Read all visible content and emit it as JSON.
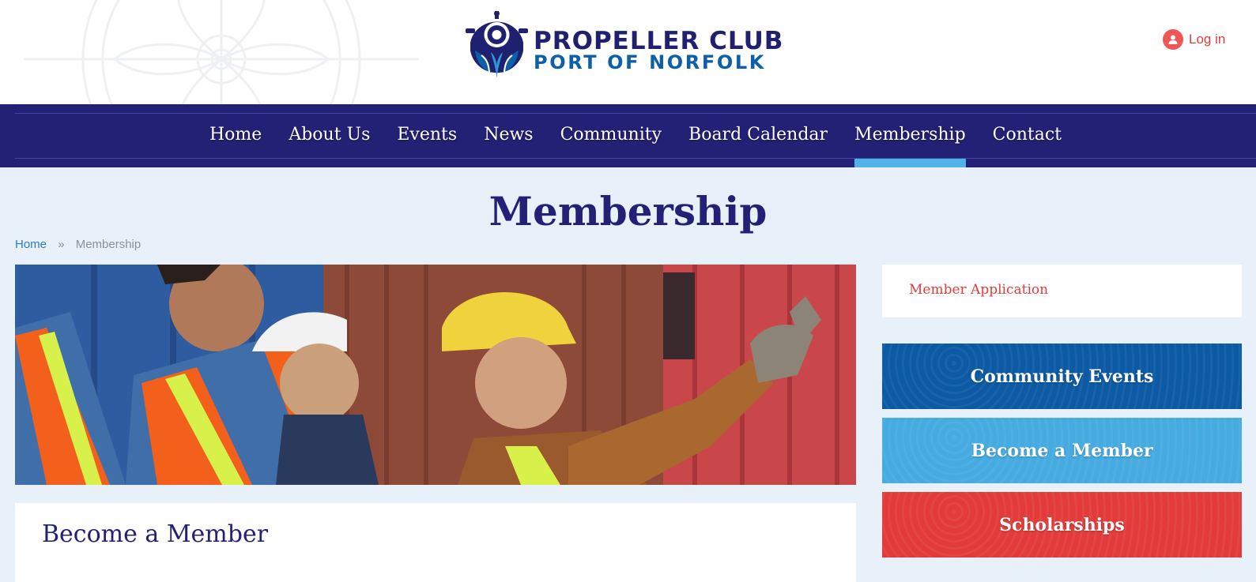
{
  "header": {
    "logo_line1": "PROPELLER CLUB",
    "logo_line2": "PORT OF NORFOLK",
    "login_label": "Log in"
  },
  "nav": {
    "items": [
      {
        "label": "Home"
      },
      {
        "label": "About Us"
      },
      {
        "label": "Events"
      },
      {
        "label": "News"
      },
      {
        "label": "Community"
      },
      {
        "label": "Board Calendar"
      },
      {
        "label": "Membership",
        "active": true
      },
      {
        "label": "Contact"
      }
    ]
  },
  "page": {
    "title": "Membership",
    "breadcrumb": {
      "home": "Home",
      "separator": "»",
      "current": "Membership"
    }
  },
  "content": {
    "heading": "Become a Member"
  },
  "sidebar": {
    "link": "Member Application",
    "buttons": [
      {
        "label": "Community Events",
        "color": "#0b5aa3"
      },
      {
        "label": "Become a Member",
        "color": "#46abe1"
      },
      {
        "label": "Scholarships",
        "color": "#e33b3b"
      }
    ]
  },
  "colors": {
    "navy": "#232175",
    "accent_blue": "#4fb3e8",
    "accent_red": "#e03c3c"
  }
}
